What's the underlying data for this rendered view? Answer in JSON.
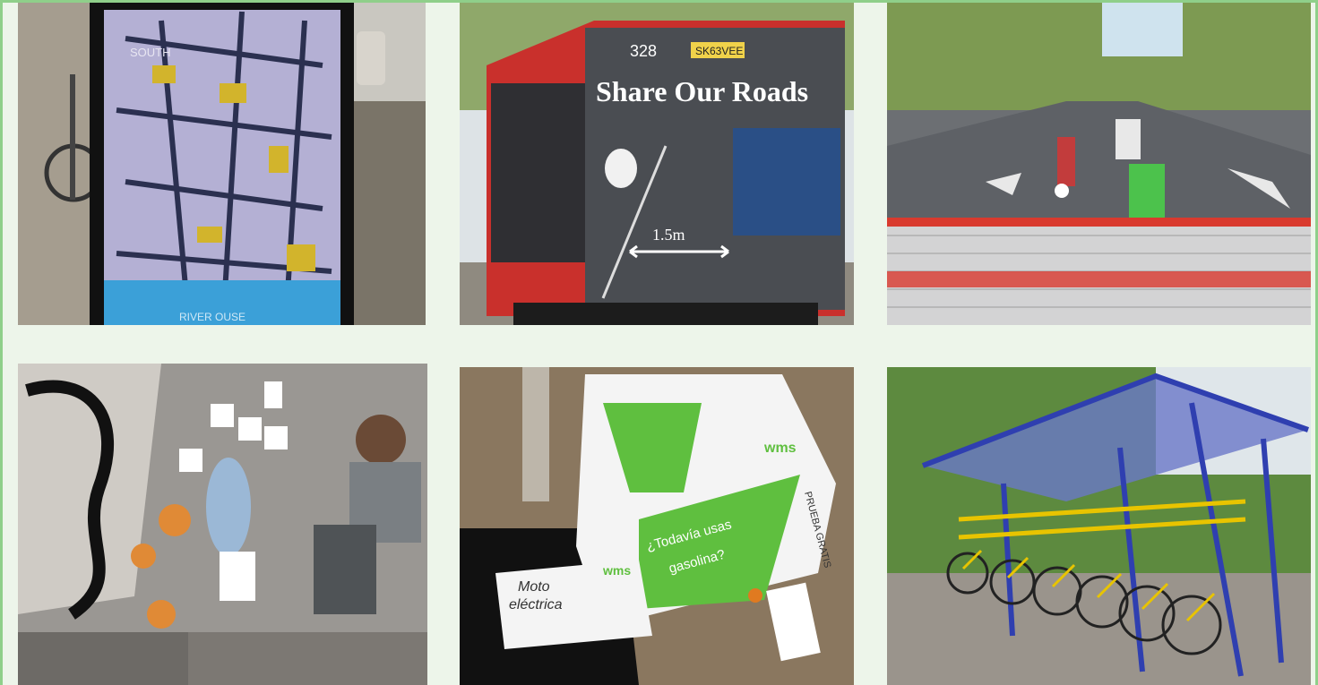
{
  "colors": {
    "frame_border": "#8fcf8a",
    "frame_background": "#edf5ea",
    "bus_red": "#c9302c",
    "scooter_green": "#5fbf3f",
    "shelter_blue": "#2f3fb0",
    "bike_yellow": "#e8c400"
  },
  "photos": {
    "map_sign": {
      "texts": {
        "top_label": "SOUTH",
        "bottom_label": "RIVER OUSE"
      }
    },
    "bus_ad": {
      "route_number": "328",
      "plate": "SK63VEE",
      "headline": "Share Our Roads",
      "distance": "1.5m"
    },
    "street_play": {},
    "kids_wall": {},
    "scooter": {
      "slogan_line1": "¿Todavía usas",
      "slogan_line2": "gasolina?",
      "brand": "wms",
      "side_text_line1": "Moto",
      "side_text_line2": "eléctrica",
      "test_text": "PRUEBA GRATIS"
    },
    "bike_shelter": {}
  }
}
